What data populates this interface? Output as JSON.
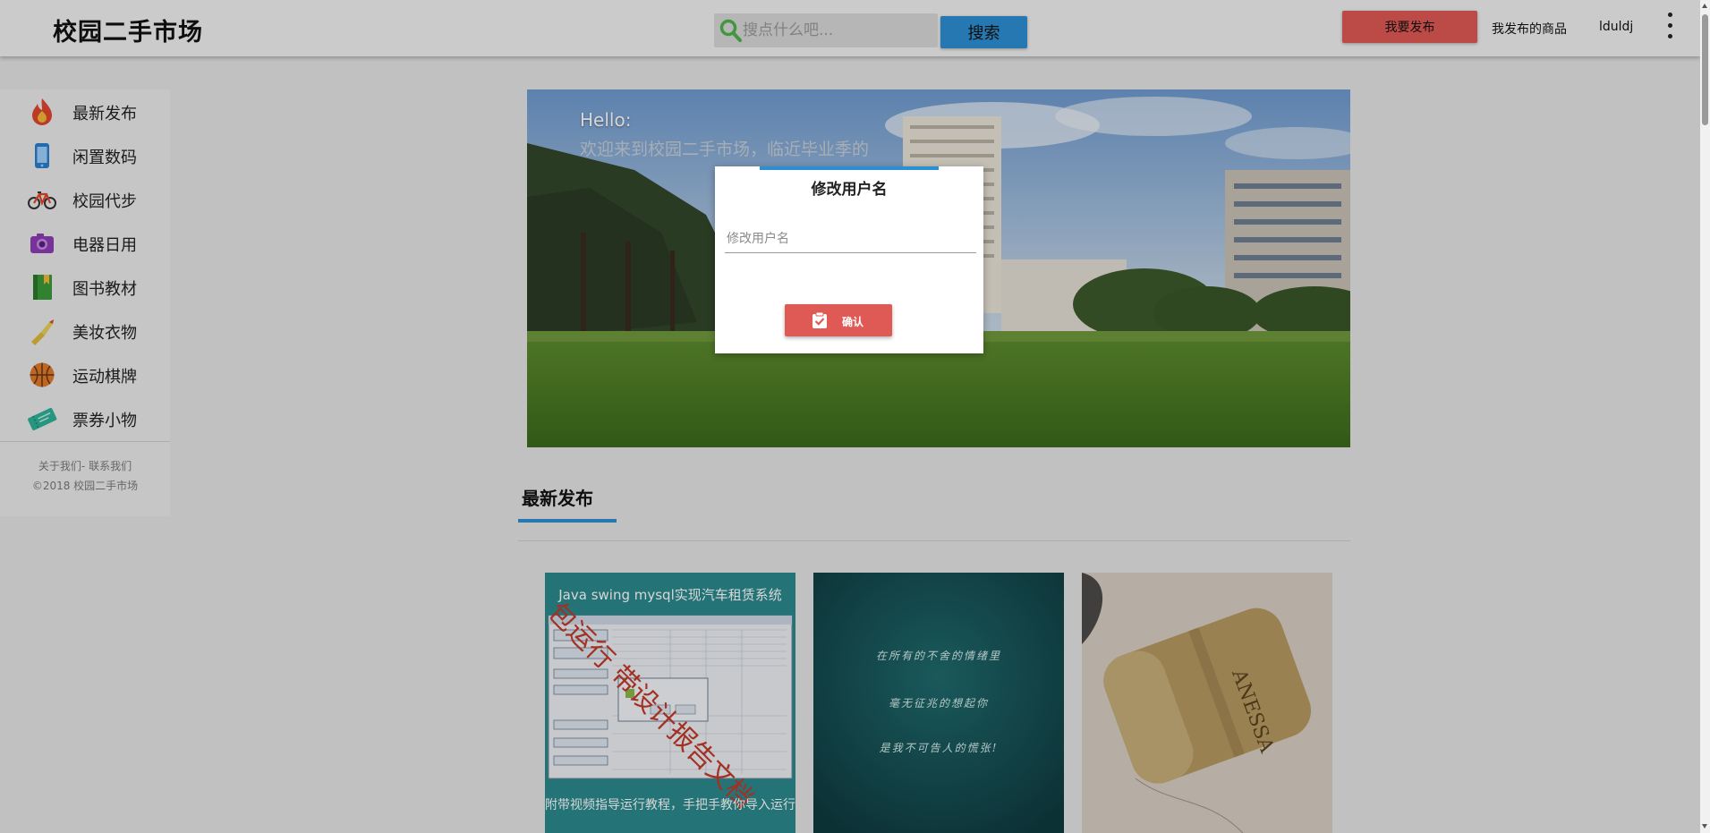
{
  "header": {
    "brand": "校园二手市场",
    "search_placeholder": "搜点什么吧...",
    "search_button": "搜索",
    "publish_button": "我要发布",
    "my_items": "我发布的商品",
    "username": "lduldj"
  },
  "sidebar": {
    "items": [
      {
        "label": "最新发布",
        "icon": "flame-icon"
      },
      {
        "label": "闲置数码",
        "icon": "phone-icon"
      },
      {
        "label": "校园代步",
        "icon": "bicycle-icon"
      },
      {
        "label": "电器日用",
        "icon": "camera-icon"
      },
      {
        "label": "图书教材",
        "icon": "book-icon"
      },
      {
        "label": "美妆衣物",
        "icon": "lipstick-icon"
      },
      {
        "label": "运动棋牌",
        "icon": "basketball-icon"
      },
      {
        "label": "票券小物",
        "icon": "ticket-icon"
      }
    ],
    "footer_links": "关于我们- 联系我们",
    "copyright": "©2018 校园二手市场"
  },
  "hero": {
    "hello": "Hello:",
    "welcome": "欢迎来到校园二手市场，临近毕业季的"
  },
  "section": {
    "title": "最新发布"
  },
  "cards": [
    {
      "headline": "Java swing mysql实现汽车租赁系统",
      "watermark": "包运行 带设计报告文档",
      "footer": "附带视频指导运行教程，手把手教你导入运行"
    },
    {
      "lines": [
        "在所有的不舍的情绪里",
        "毫无征兆的想起你",
        "是我不可告人的慌张!"
      ]
    },
    {
      "brand": "ANESSA"
    }
  ],
  "modal": {
    "title": "修改用户名",
    "input_placeholder": "修改用户名",
    "confirm_button": "确认"
  },
  "colors": {
    "accent_blue": "#2d8fd3",
    "accent_red": "#e05a55"
  }
}
